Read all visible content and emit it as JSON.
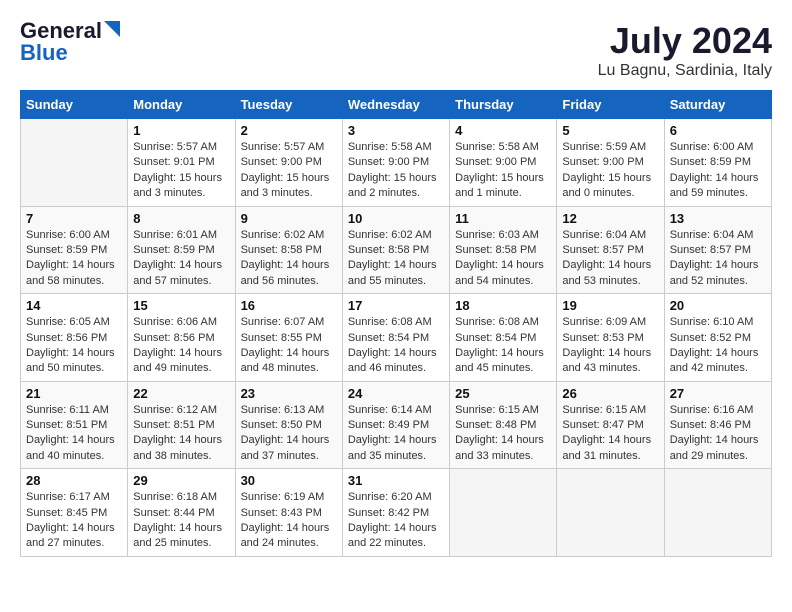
{
  "logo": {
    "general": "General",
    "blue": "Blue"
  },
  "title": "July 2024",
  "location": "Lu Bagnu, Sardinia, Italy",
  "days_of_week": [
    "Sunday",
    "Monday",
    "Tuesday",
    "Wednesday",
    "Thursday",
    "Friday",
    "Saturday"
  ],
  "weeks": [
    [
      {
        "num": "",
        "info": ""
      },
      {
        "num": "1",
        "info": "Sunrise: 5:57 AM\nSunset: 9:01 PM\nDaylight: 15 hours\nand 3 minutes."
      },
      {
        "num": "2",
        "info": "Sunrise: 5:57 AM\nSunset: 9:00 PM\nDaylight: 15 hours\nand 3 minutes."
      },
      {
        "num": "3",
        "info": "Sunrise: 5:58 AM\nSunset: 9:00 PM\nDaylight: 15 hours\nand 2 minutes."
      },
      {
        "num": "4",
        "info": "Sunrise: 5:58 AM\nSunset: 9:00 PM\nDaylight: 15 hours\nand 1 minute."
      },
      {
        "num": "5",
        "info": "Sunrise: 5:59 AM\nSunset: 9:00 PM\nDaylight: 15 hours\nand 0 minutes."
      },
      {
        "num": "6",
        "info": "Sunrise: 6:00 AM\nSunset: 8:59 PM\nDaylight: 14 hours\nand 59 minutes."
      }
    ],
    [
      {
        "num": "7",
        "info": "Sunrise: 6:00 AM\nSunset: 8:59 PM\nDaylight: 14 hours\nand 58 minutes."
      },
      {
        "num": "8",
        "info": "Sunrise: 6:01 AM\nSunset: 8:59 PM\nDaylight: 14 hours\nand 57 minutes."
      },
      {
        "num": "9",
        "info": "Sunrise: 6:02 AM\nSunset: 8:58 PM\nDaylight: 14 hours\nand 56 minutes."
      },
      {
        "num": "10",
        "info": "Sunrise: 6:02 AM\nSunset: 8:58 PM\nDaylight: 14 hours\nand 55 minutes."
      },
      {
        "num": "11",
        "info": "Sunrise: 6:03 AM\nSunset: 8:58 PM\nDaylight: 14 hours\nand 54 minutes."
      },
      {
        "num": "12",
        "info": "Sunrise: 6:04 AM\nSunset: 8:57 PM\nDaylight: 14 hours\nand 53 minutes."
      },
      {
        "num": "13",
        "info": "Sunrise: 6:04 AM\nSunset: 8:57 PM\nDaylight: 14 hours\nand 52 minutes."
      }
    ],
    [
      {
        "num": "14",
        "info": "Sunrise: 6:05 AM\nSunset: 8:56 PM\nDaylight: 14 hours\nand 50 minutes."
      },
      {
        "num": "15",
        "info": "Sunrise: 6:06 AM\nSunset: 8:56 PM\nDaylight: 14 hours\nand 49 minutes."
      },
      {
        "num": "16",
        "info": "Sunrise: 6:07 AM\nSunset: 8:55 PM\nDaylight: 14 hours\nand 48 minutes."
      },
      {
        "num": "17",
        "info": "Sunrise: 6:08 AM\nSunset: 8:54 PM\nDaylight: 14 hours\nand 46 minutes."
      },
      {
        "num": "18",
        "info": "Sunrise: 6:08 AM\nSunset: 8:54 PM\nDaylight: 14 hours\nand 45 minutes."
      },
      {
        "num": "19",
        "info": "Sunrise: 6:09 AM\nSunset: 8:53 PM\nDaylight: 14 hours\nand 43 minutes."
      },
      {
        "num": "20",
        "info": "Sunrise: 6:10 AM\nSunset: 8:52 PM\nDaylight: 14 hours\nand 42 minutes."
      }
    ],
    [
      {
        "num": "21",
        "info": "Sunrise: 6:11 AM\nSunset: 8:51 PM\nDaylight: 14 hours\nand 40 minutes."
      },
      {
        "num": "22",
        "info": "Sunrise: 6:12 AM\nSunset: 8:51 PM\nDaylight: 14 hours\nand 38 minutes."
      },
      {
        "num": "23",
        "info": "Sunrise: 6:13 AM\nSunset: 8:50 PM\nDaylight: 14 hours\nand 37 minutes."
      },
      {
        "num": "24",
        "info": "Sunrise: 6:14 AM\nSunset: 8:49 PM\nDaylight: 14 hours\nand 35 minutes."
      },
      {
        "num": "25",
        "info": "Sunrise: 6:15 AM\nSunset: 8:48 PM\nDaylight: 14 hours\nand 33 minutes."
      },
      {
        "num": "26",
        "info": "Sunrise: 6:15 AM\nSunset: 8:47 PM\nDaylight: 14 hours\nand 31 minutes."
      },
      {
        "num": "27",
        "info": "Sunrise: 6:16 AM\nSunset: 8:46 PM\nDaylight: 14 hours\nand 29 minutes."
      }
    ],
    [
      {
        "num": "28",
        "info": "Sunrise: 6:17 AM\nSunset: 8:45 PM\nDaylight: 14 hours\nand 27 minutes."
      },
      {
        "num": "29",
        "info": "Sunrise: 6:18 AM\nSunset: 8:44 PM\nDaylight: 14 hours\nand 25 minutes."
      },
      {
        "num": "30",
        "info": "Sunrise: 6:19 AM\nSunset: 8:43 PM\nDaylight: 14 hours\nand 24 minutes."
      },
      {
        "num": "31",
        "info": "Sunrise: 6:20 AM\nSunset: 8:42 PM\nDaylight: 14 hours\nand 22 minutes."
      },
      {
        "num": "",
        "info": ""
      },
      {
        "num": "",
        "info": ""
      },
      {
        "num": "",
        "info": ""
      }
    ]
  ]
}
